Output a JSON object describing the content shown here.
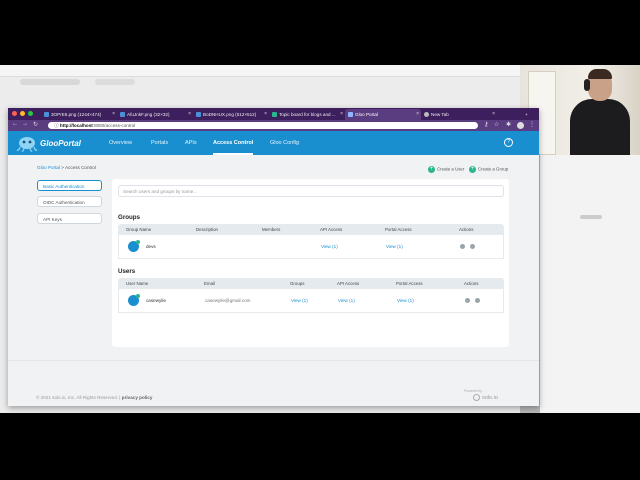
{
  "browser": {
    "tabs": [
      {
        "label": "3OPrE6.png (1244×474)",
        "icon_color": "#4a90d9",
        "active": false
      },
      {
        "label": "AfuJnkF.png (32×32)",
        "icon_color": "#4a90d9",
        "active": false
      },
      {
        "label": "BoDNHUX.png (512×512)",
        "icon_color": "#4a90d9",
        "active": false
      },
      {
        "label": "Topic board for blogs and ...",
        "icon_color": "#2ab58f",
        "active": false
      },
      {
        "label": "Gloo Portal",
        "icon_color": "#8fb7ff",
        "active": true
      },
      {
        "label": "New Tab",
        "icon_color": "#bbbbbb",
        "active": false
      }
    ],
    "url_host": "http://localhost",
    "url_rest": ":8080/access-control",
    "new_tab_symbol": "+"
  },
  "app": {
    "logo_text": "GlooPortal",
    "nav": [
      "Overview",
      "Portals",
      "APIs",
      "Access Control",
      "Gloo Config"
    ],
    "active_nav": "Access Control",
    "help_symbol": "?"
  },
  "breadcrumb": {
    "root": "Gloo Portal",
    "separator": ">",
    "current": "Access Control"
  },
  "actions": {
    "create_user": "Create a User",
    "create_group": "Create a Group"
  },
  "sidebar": {
    "items": [
      "Basic Authentication",
      "OIDC Authentication",
      "API Keys"
    ],
    "active_index": 0
  },
  "search": {
    "placeholder": "Search users and groups by name..."
  },
  "groups": {
    "title": "Groups",
    "columns": [
      "Group Name",
      "Description",
      "Members",
      "API Access",
      "Portal Access",
      "Actions"
    ],
    "rows": [
      {
        "name": "devs",
        "description": "",
        "members": "",
        "api_access": "View (1)",
        "portal_access": "View (1)"
      }
    ]
  },
  "users": {
    "title": "Users",
    "columns": [
      "User Name",
      "Email",
      "Groups",
      "API Access",
      "Portal Access",
      "Actions"
    ],
    "rows": [
      {
        "name": "casewylie",
        "email": "casewylie@gmail.com",
        "groups": "View (1)",
        "api_access": "View (1)",
        "portal_access": "View (1)"
      }
    ]
  },
  "footer": {
    "copyright": "© 2021 solo.io, Inc. All Rights Reserved. |",
    "privacy": "privacy policy",
    "powered_by": "Powered by",
    "brand": "solo.io"
  },
  "colors": {
    "primary": "#1a8fd0",
    "accent": "#2ab58f",
    "chrome": "#3d1f5e"
  }
}
